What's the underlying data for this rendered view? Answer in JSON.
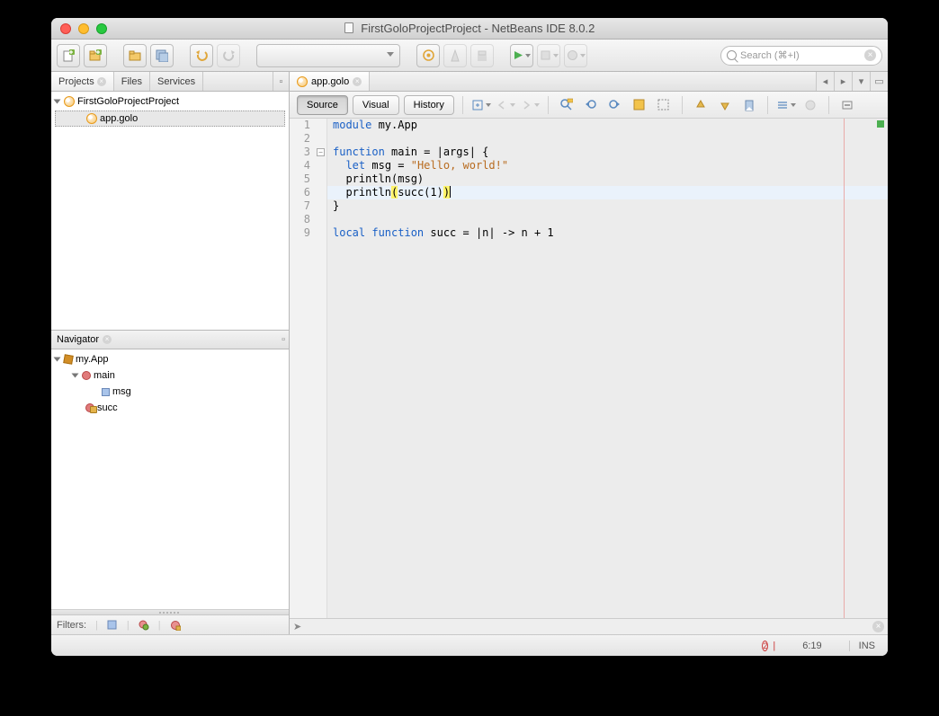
{
  "window": {
    "title": "FirstGoloProjectProject - NetBeans IDE 8.0.2"
  },
  "toolbar": {
    "search_placeholder": "Search (⌘+I)"
  },
  "left_tabs": {
    "projects": "Projects",
    "files": "Files",
    "services": "Services"
  },
  "projects": {
    "root": "FirstGoloProjectProject",
    "file": "app.golo"
  },
  "navigator": {
    "title": "Navigator",
    "module": "my.App",
    "fn_main": "main",
    "var_msg": "msg",
    "fn_succ": "succ"
  },
  "filters": {
    "label": "Filters:"
  },
  "editor": {
    "tab": "app.golo",
    "views": {
      "source": "Source",
      "visual": "Visual",
      "history": "History"
    }
  },
  "code": {
    "l1": {
      "kw": "module",
      "rest": " my.App"
    },
    "l3": {
      "kw": "function",
      "rest": " main = |args| {"
    },
    "l4": {
      "kw": "let",
      "mid": " msg = ",
      "str": "\"Hello, world!\""
    },
    "l5": "  println(msg)",
    "l6": {
      "a": "  println",
      "b": "(",
      "c": "succ(1)",
      "d": ")"
    },
    "l7": "}",
    "l9": {
      "kw1": "local",
      "kw2": "function",
      "rest": " succ = |n| -> n + 1"
    }
  },
  "status": {
    "errors": "2",
    "cursor": "6:19",
    "mode": "INS"
  }
}
